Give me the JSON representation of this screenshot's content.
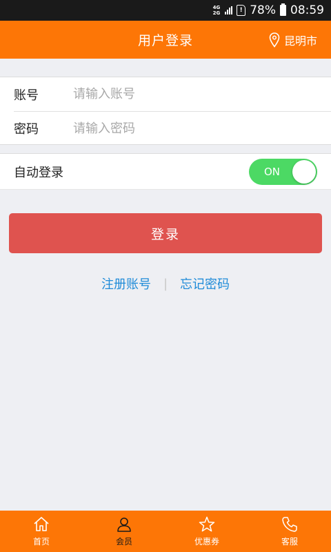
{
  "status_bar": {
    "network_top": "4G",
    "network_bottom": "2G",
    "sim_label": "!",
    "battery": "78%",
    "time": "08:59"
  },
  "header": {
    "title": "用户登录",
    "location": "昆明市"
  },
  "form": {
    "account_label": "账号",
    "account_placeholder": "请输入账号",
    "account_value": "",
    "password_label": "密码",
    "password_placeholder": "请输入密码",
    "password_value": ""
  },
  "auto_login": {
    "label": "自动登录",
    "toggle_text": "ON",
    "enabled": true
  },
  "login_button": "登录",
  "links": {
    "register": "注册账号",
    "separator": "|",
    "forgot": "忘记密码"
  },
  "bottom_nav": [
    {
      "label": "首页",
      "icon": "home-icon"
    },
    {
      "label": "会员",
      "icon": "user-icon",
      "active": true
    },
    {
      "label": "优惠券",
      "icon": "star-icon"
    },
    {
      "label": "客服",
      "icon": "phone-icon"
    }
  ],
  "colors": {
    "primary_orange": "#fd7606",
    "login_red": "#df534f",
    "toggle_green": "#4cd964",
    "link_blue": "#1f8bd8",
    "background": "#eeeff3"
  }
}
